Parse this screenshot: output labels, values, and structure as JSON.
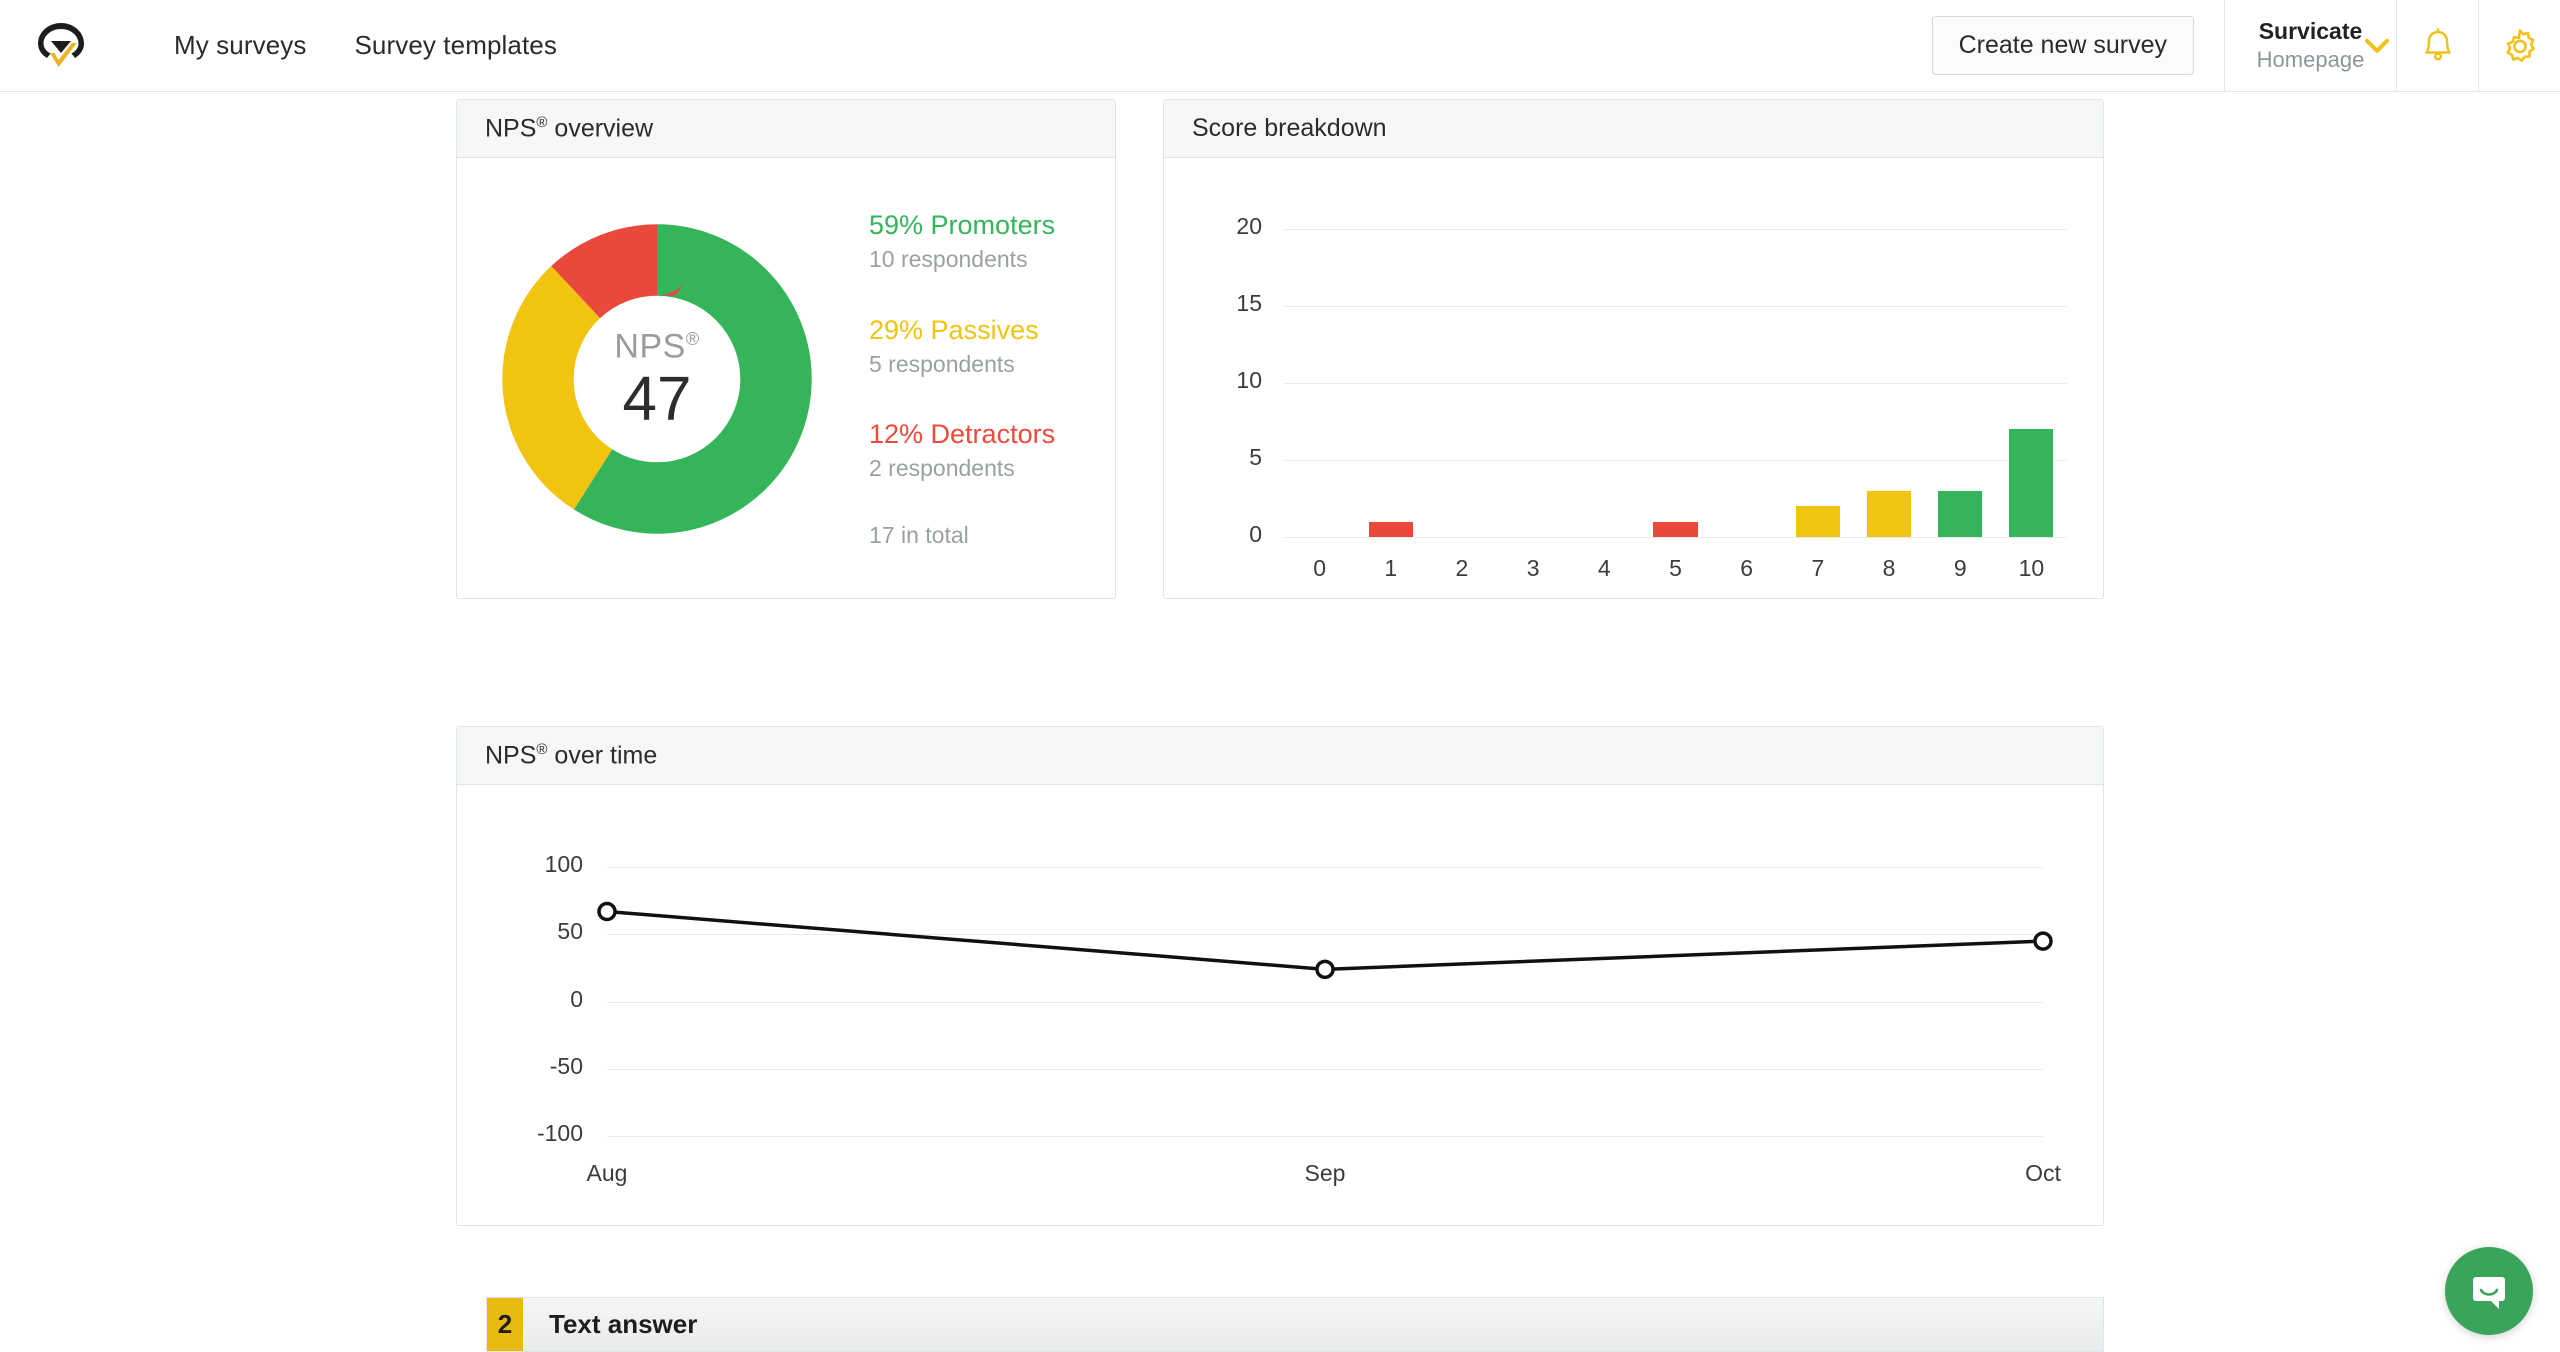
{
  "header": {
    "logo_alt": "Survicate logo",
    "nav": [
      {
        "label": "My surveys"
      },
      {
        "label": "Survey templates"
      }
    ],
    "create_button": "Create new survey",
    "account": {
      "name": "Survicate",
      "workspace": "Homepage"
    },
    "icons": {
      "notifications": "bell-icon",
      "settings": "gear-icon",
      "caret": "chevron-down-icon"
    },
    "accent_color": "#efc119"
  },
  "colors": {
    "promoter_green": "#35b45a",
    "passive_yellow": "#f0c411",
    "detractor_red": "#e8493c",
    "brand_yellow": "#efc119",
    "grid": "#e8ecee",
    "text_muted": "#9aa0a3"
  },
  "nps_overview": {
    "title": "NPS",
    "title_sup": "®",
    "title_rest": " overview",
    "center_label": "NPS",
    "center_label_sup": "®",
    "center_value": "47",
    "legend": [
      {
        "main": "59% Promoters",
        "sub": "10 respondents",
        "color": "#35b45a"
      },
      {
        "main": "29% Passives",
        "sub": "5 respondents",
        "color": "#f0c411"
      },
      {
        "main": "12% Detractors",
        "sub": "2 respondents",
        "color": "#ec4a3b"
      }
    ],
    "total": "17 in total"
  },
  "score_breakdown": {
    "title": "Score breakdown"
  },
  "nps_over_time": {
    "title": "NPS",
    "title_sup": "®",
    "title_rest": " over time"
  },
  "question_strip": {
    "number": "2",
    "label": "Text answer"
  },
  "intercom": {
    "icon": "chat-bubble-icon"
  },
  "chart_data": [
    {
      "type": "pie",
      "title": "NPS® overview",
      "subtype": "donut",
      "center_text": "NPS®",
      "center_value": 47,
      "labels": [
        "Promoters",
        "Passives",
        "Detractors"
      ],
      "values": [
        59,
        29,
        12
      ],
      "counts": [
        10,
        5,
        2
      ],
      "total_respondents": 17,
      "colors": [
        "#35b45a",
        "#f0c411",
        "#e8493c"
      ],
      "legend": "right",
      "start_angle_deg": 0
    },
    {
      "type": "bar",
      "title": "Score breakdown",
      "categories": [
        "0",
        "1",
        "2",
        "3",
        "4",
        "5",
        "6",
        "7",
        "8",
        "9",
        "10"
      ],
      "values": [
        0,
        1,
        0,
        0,
        0,
        1,
        0,
        2,
        3,
        3,
        7
      ],
      "bar_colors": [
        "#e8493c",
        "#e8493c",
        "#e8493c",
        "#e8493c",
        "#e8493c",
        "#e8493c",
        "#e8493c",
        "#f0c411",
        "#f0c411",
        "#35b45a",
        "#35b45a"
      ],
      "xlabel": "",
      "ylabel": "",
      "ylim": [
        0,
        22
      ],
      "yticks": [
        0,
        5,
        10,
        15,
        20
      ],
      "grid": true,
      "legend": "none"
    },
    {
      "type": "line",
      "title": "NPS® over time",
      "x": [
        "Aug",
        "Sep",
        "Oct"
      ],
      "values": [
        67,
        24,
        45
      ],
      "xlabel": "",
      "ylabel": "",
      "ylim": [
        -100,
        115
      ],
      "yticks": [
        -100,
        -50,
        0,
        50,
        100
      ],
      "grid": true,
      "line_color": "#111111",
      "marker": "circle-open",
      "legend": "none"
    }
  ]
}
